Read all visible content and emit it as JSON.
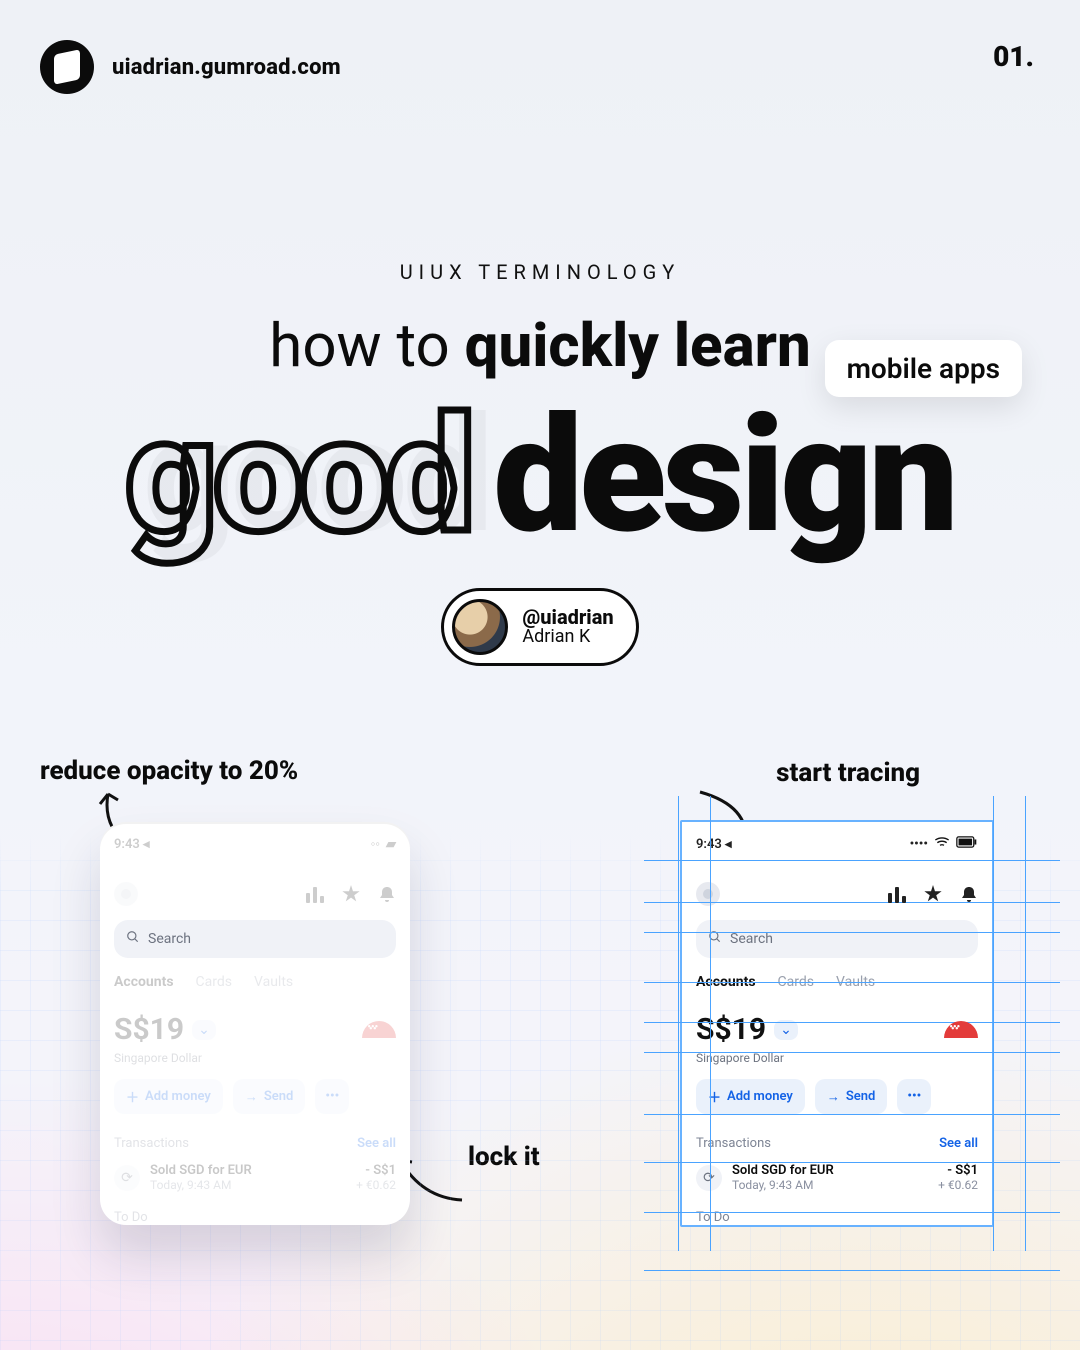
{
  "header": {
    "url": "uiadrian.gumroad.com",
    "page": "01."
  },
  "title": {
    "eyebrow": "UIUX TERMINOLOGY",
    "line_pre": "how to ",
    "line_bold": "quickly learn",
    "tag": "mobile apps",
    "big_outline": "good",
    "big_solid": "design"
  },
  "author": {
    "handle": "@uiadrian",
    "name": "Adrian K"
  },
  "annotations": {
    "opacity": "reduce opacity to 20%",
    "lock": "lock it",
    "trace": "start tracing"
  },
  "mockup": {
    "status_time": "9:43",
    "search_placeholder": "Search",
    "tabs": [
      "Accounts",
      "Cards",
      "Vaults"
    ],
    "amount": "S$19",
    "currency_label": "Singapore Dollar",
    "buttons": {
      "add": "Add money",
      "send": "Send",
      "more": "•••"
    },
    "transactions_label": "Transactions",
    "see_all": "See all",
    "tx": {
      "title": "Sold SGD for EUR",
      "subtitle": "Today, 9:43 AM",
      "amount1": "- S$1",
      "amount2": "+ €0.62"
    },
    "todo": "To Do"
  }
}
